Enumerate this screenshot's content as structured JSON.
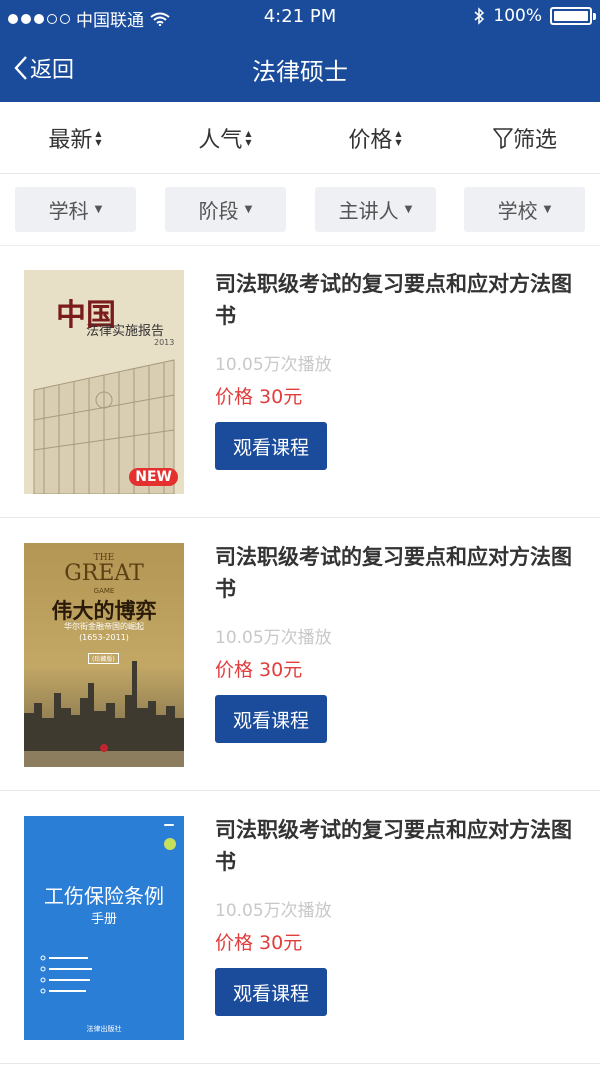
{
  "status_bar": {
    "carrier": "中国联通",
    "time": "4:21 PM",
    "battery": "100%",
    "battery_level": 1.0
  },
  "navbar": {
    "back_label": "返回",
    "title": "法律硕士"
  },
  "sort_bar": {
    "items": [
      {
        "label": "最新"
      },
      {
        "label": "人气"
      },
      {
        "label": "价格"
      },
      {
        "label": "筛选"
      }
    ]
  },
  "filters": {
    "chips": [
      {
        "label": "学科"
      },
      {
        "label": "阶段"
      },
      {
        "label": "主讲人"
      },
      {
        "label": "学校"
      }
    ]
  },
  "courses": [
    {
      "title": "司法职级考试的复习要点和应对方法图书",
      "plays": "10.05万次播放",
      "price": "价格 30元",
      "button": "观看课程",
      "cover": {
        "title_cn": "中国",
        "subtitle": "法律实施报告",
        "year": "2013",
        "badge": "NEW"
      }
    },
    {
      "title": "司法职级考试的复习要点和应对方法图书",
      "plays": "10.05万次播放",
      "price": "价格 30元",
      "button": "观看课程",
      "cover": {
        "the": "THE",
        "great": "GREAT",
        "game": "GAME",
        "title_cn": "伟大的博弈",
        "subtitle": "华尔街金融帝国的崛起",
        "years": "(1653-2011)",
        "badge": "(珍藏版)"
      }
    },
    {
      "title": "司法职级考试的复习要点和应对方法图书",
      "plays": "10.05万次播放",
      "price": "价格 30元",
      "button": "观看课程",
      "cover": {
        "title_cn": "工伤保险条例",
        "subtitle": "手册",
        "publisher": "法律出版社"
      }
    }
  ],
  "colors": {
    "brand": "#1b4c9c",
    "price": "#e23d3d",
    "muted": "#c8c8c8"
  }
}
